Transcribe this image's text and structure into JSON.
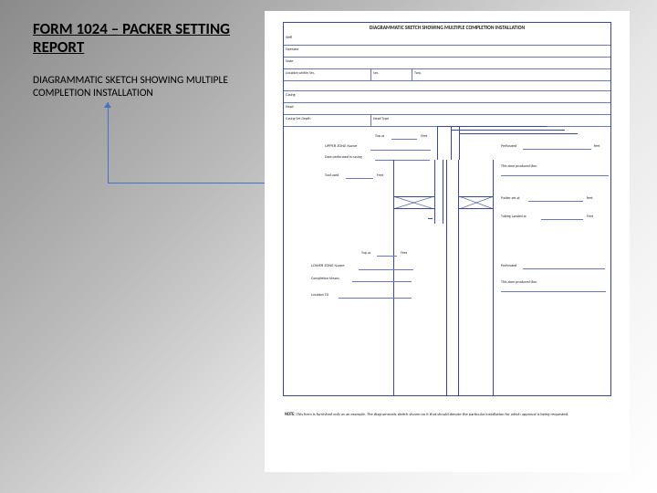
{
  "title": "FORM 1024 – PACKER SETTING REPORT",
  "subtitle": "DIAGRAMMATIC SKETCH SHOWING MULTIPLE COMPLETION INSTALLATION",
  "form": {
    "heading": "DIAGRAMMATIC SKETCH SHOWING MULTIPLE COMPLETION INSTALLATION",
    "rows": {
      "well": "Well",
      "operator": "Operator",
      "state": "State",
      "location": "Location within Sec.",
      "sec": "Sec.",
      "twp": "Twp.",
      "casing": "Casing",
      "head": "Head",
      "casing_set": "Casing Set Depth",
      "head_type": "Head Type"
    },
    "upper_zone": {
      "label": "UPPER ZONE Name",
      "date_perf": "Date perforated in casing",
      "tool": "Tool used",
      "top": "Top at",
      "feet": "Feet",
      "perforated": "Perforated",
      "this_zone": "This zone produced thru"
    },
    "packer": {
      "packer_set": "Packer set at",
      "tubing_landed": "Tubing Landed at",
      "feet": "feet",
      "feet2": "Feet"
    },
    "lower_zone": {
      "label": "LOWER ZONE Name",
      "top": "Top at",
      "feet": "Feet",
      "completion": "Completion Means",
      "location_td": "Location TD",
      "perforated": "Perforated",
      "this_zone": "This zone produced thru"
    },
    "note_label": "NOTE:",
    "note_text": "This form is furnished only as an example. The diagrammatic sketch shown on it that should denote the particular installation for which approval is being requested."
  }
}
